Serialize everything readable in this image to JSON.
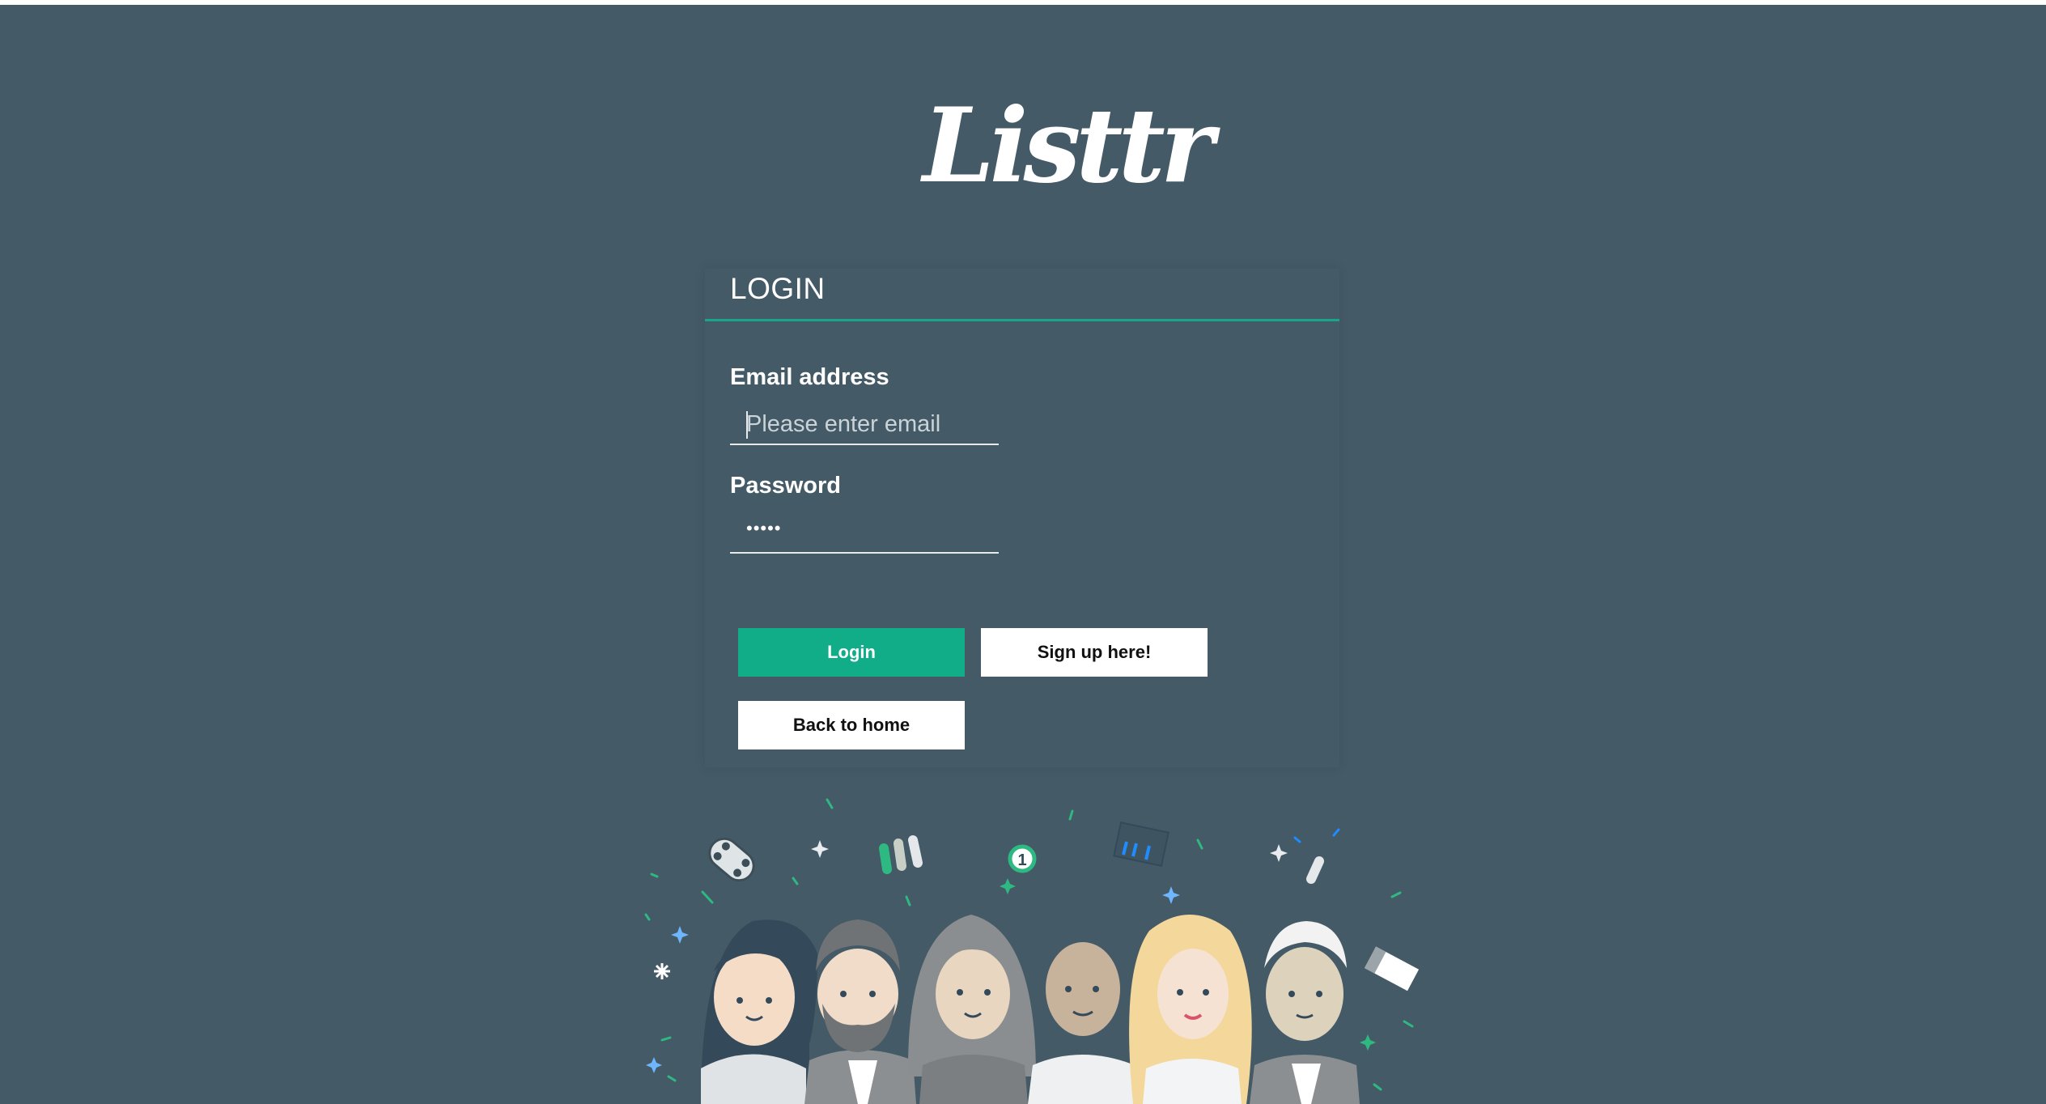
{
  "brand": {
    "logo_text": "Listtr"
  },
  "login_form": {
    "title": "LOGIN",
    "email_label": "Email address",
    "email_placeholder": "Please enter email",
    "email_value": "",
    "password_label": "Password",
    "password_value": "•••••"
  },
  "buttons": {
    "login": "Login",
    "signup": "Sign up here!",
    "back_home": "Back to home"
  },
  "illustration": {
    "badge_number": "1"
  },
  "colors": {
    "background": "#445a66",
    "accent": "#11ad88",
    "white": "#ffffff"
  }
}
